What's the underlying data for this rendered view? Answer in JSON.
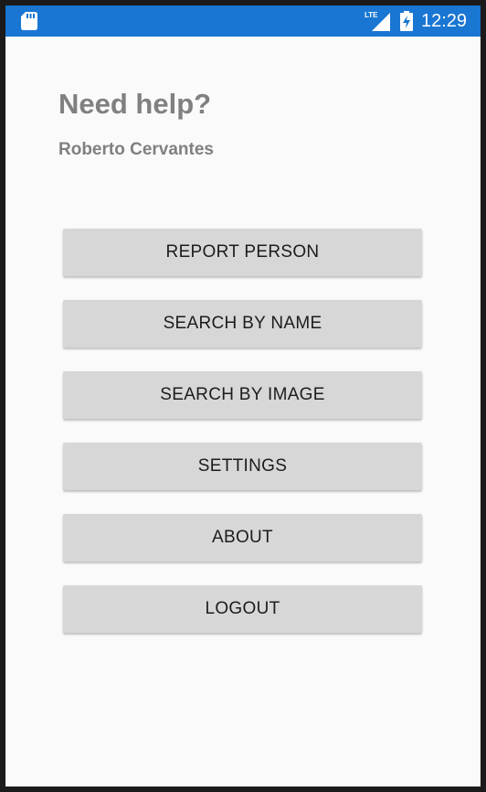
{
  "status_bar": {
    "network": "LTE",
    "time": "12:29",
    "background_color": "#1976d2",
    "icons": [
      "sd-card-icon",
      "lte-signal-icon",
      "battery-charging-icon"
    ]
  },
  "header": {
    "title": "Need help?",
    "subtitle": "Roberto Cervantes"
  },
  "menu": {
    "buttons": [
      {
        "label": "REPORT PERSON"
      },
      {
        "label": "SEARCH BY NAME"
      },
      {
        "label": "SEARCH BY IMAGE"
      },
      {
        "label": "SETTINGS"
      },
      {
        "label": "ABOUT"
      },
      {
        "label": "LOGOUT"
      }
    ],
    "button_color": "#d7d7d7"
  },
  "colors": {
    "background": "#fafafa",
    "header_text": "#808080",
    "button_text": "#1c1c1c"
  }
}
